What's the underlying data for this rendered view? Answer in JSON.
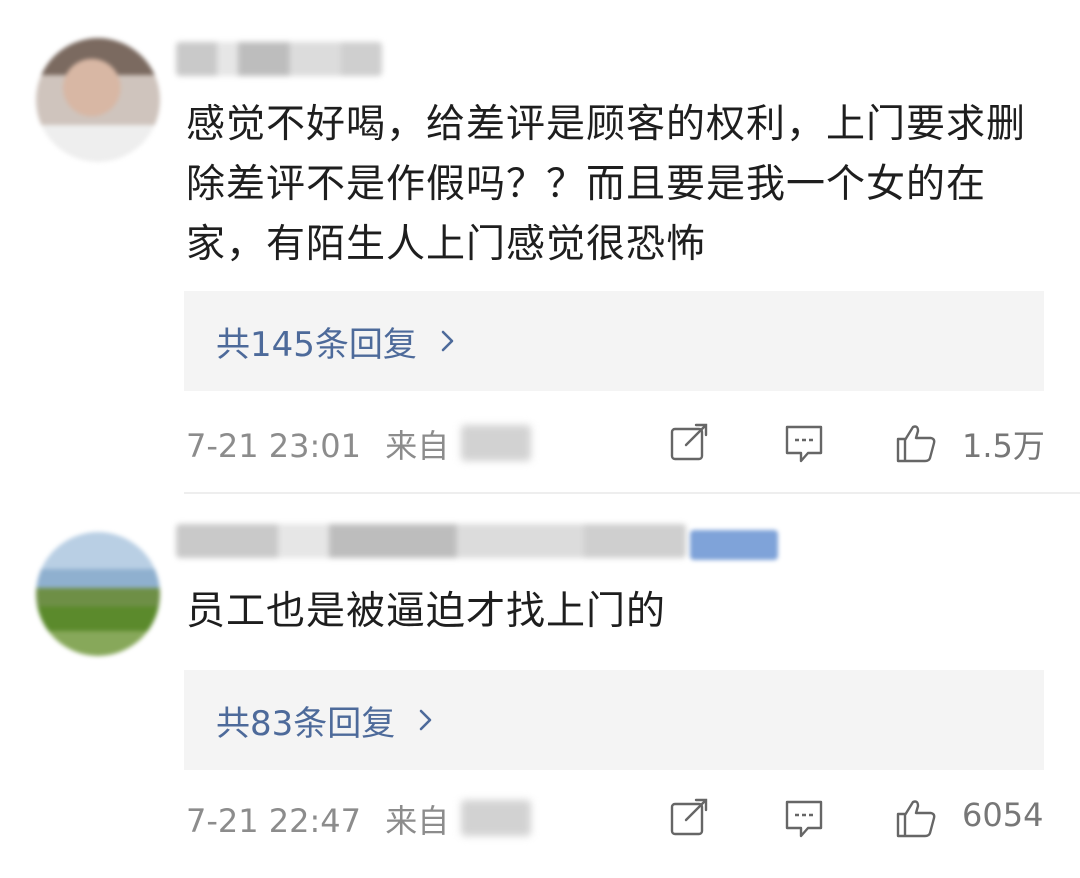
{
  "comments": [
    {
      "text": "感觉不好喝，给差评是顾客的权利，上门要求删除差评不是作假吗？？而且要是我一个女的在家，有陌生人上门感觉很恐怖",
      "replies_label": "共145条回复",
      "timestamp": "7-21 23:01",
      "source_label": "来自",
      "likes": "1.5万"
    },
    {
      "text": "员工也是被逼迫才找上门的",
      "replies_label": "共83条回复",
      "timestamp": "7-21 22:47",
      "source_label": "来自",
      "likes": "6054"
    }
  ],
  "icons": {
    "share": "share-icon",
    "comment": "comment-icon",
    "like": "thumbs-up-icon",
    "chevron": "chevron-right-icon"
  },
  "colors": {
    "reply_link": "#4d6a9a",
    "meta_text": "#8c8c8c",
    "reply_bg": "#f4f4f4"
  }
}
